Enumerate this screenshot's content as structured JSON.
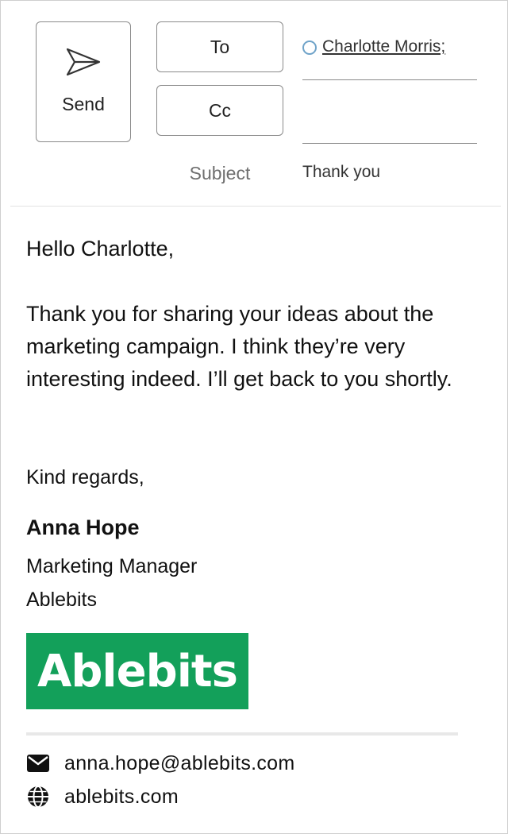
{
  "compose": {
    "send_label": "Send",
    "to_label": "To",
    "cc_label": "Cc",
    "subject_label": "Subject",
    "to_recipient": "Charlotte Morris;",
    "cc_value": "",
    "subject_value": "Thank you"
  },
  "body": {
    "greeting": "Hello Charlotte,",
    "paragraph": "Thank you for sharing your ideas about the marketing campaign. I think they’re very interesting indeed. I’ll get back to you shortly.",
    "closing": "Kind regards,"
  },
  "signature": {
    "name": "Anna Hope",
    "title": "Marketing Manager",
    "company": "Ablebits",
    "logo_text": "Ablebits",
    "logo_color": "#13a05a",
    "email": "anna.hope@ablebits.com",
    "website": "ablebits.com"
  },
  "icons": {
    "send": "send-icon",
    "presence": "presence-icon",
    "email": "envelope-icon",
    "website": "globe-icon"
  }
}
